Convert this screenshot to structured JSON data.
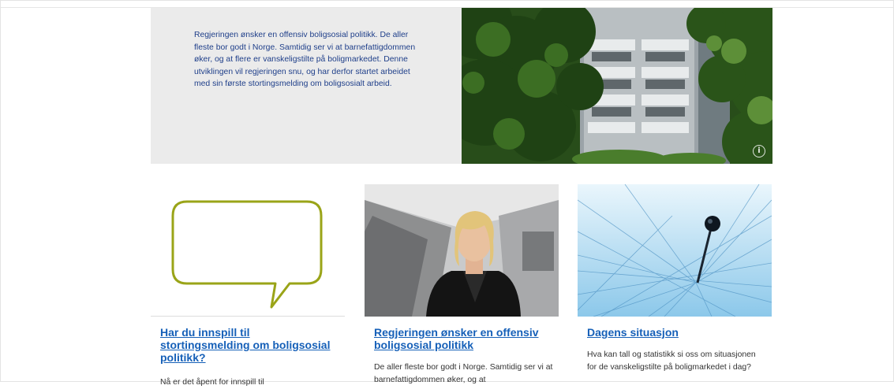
{
  "hero": {
    "text": "Regjeringen ønsker en offensiv boligsosial politikk. De aller fleste bor godt i Norge. Samtidig ser vi at barnefattigdommen øker, og at flere er vanskeligstilte på boligmarkedet. Denne utviklingen vil regjeringen snu, og har derfor startet arbeidet med sin første stortingsmelding om boligsosialt arbeid.",
    "image_icon": "apartment-building-photo",
    "info_label": "i"
  },
  "cards": [
    {
      "title": "Har du innspill til stortingsmelding om boligsosial politikk?",
      "text": "Nå er det åpent for innspill til",
      "image_icon": "speech-bubble-icon"
    },
    {
      "title": "Regjeringen ønsker en offensiv boligsosial politikk",
      "text": "De aller fleste bor godt i Norge. Samtidig ser vi at barnefattigdommen øker, og at",
      "image_icon": "minister-portrait-photo"
    },
    {
      "title": "Dagens situasjon",
      "text": "Hva kan tall og statistikk si oss om situasjonen for de vanskeligstilte på boligmarkedet i dag?",
      "image_icon": "pin-network-image"
    }
  ],
  "colors": {
    "link": "#1660b8",
    "hero_text": "#1f3f8a",
    "hero_panel": "#ebebeb",
    "bubble": "#9aa418"
  }
}
